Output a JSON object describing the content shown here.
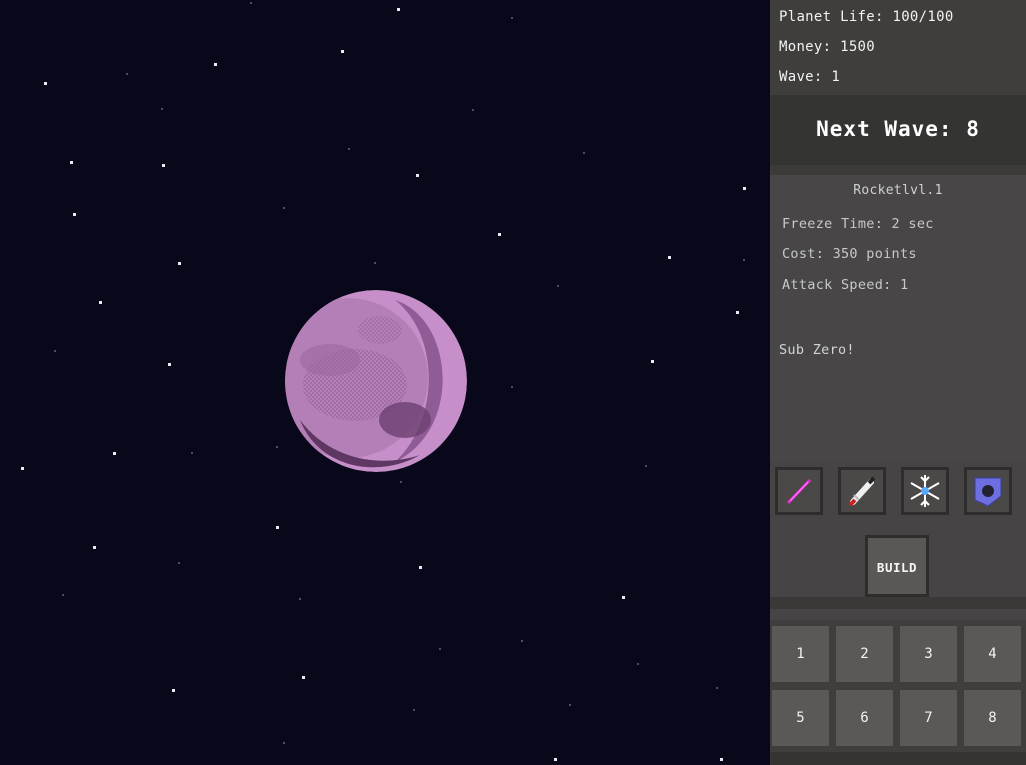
{
  "stats": {
    "planet_life": "Planet Life: 100/100",
    "money": "Money: 1500",
    "wave": "Wave: 1"
  },
  "next_wave": "Next Wave: 8",
  "tower_info": {
    "name": "Rocketlvl.1",
    "freeze_time": "Freeze Time: 2 sec",
    "cost": "Cost: 350 points",
    "attack_speed": "Attack Speed: 1",
    "description": "Sub Zero!"
  },
  "tower_buttons": [
    {
      "icon": "laser-icon"
    },
    {
      "icon": "rocket-icon"
    },
    {
      "icon": "snowflake-icon"
    },
    {
      "icon": "shield-icon"
    }
  ],
  "build_label": "BUILD",
  "slots": [
    "1",
    "2",
    "3",
    "4",
    "5",
    "6",
    "7",
    "8"
  ],
  "colors": {
    "space": "#08081a",
    "planet_light": "#c78fc9",
    "planet_dark": "#5e3762",
    "panel": "#464444",
    "slot": "#5b5957"
  }
}
